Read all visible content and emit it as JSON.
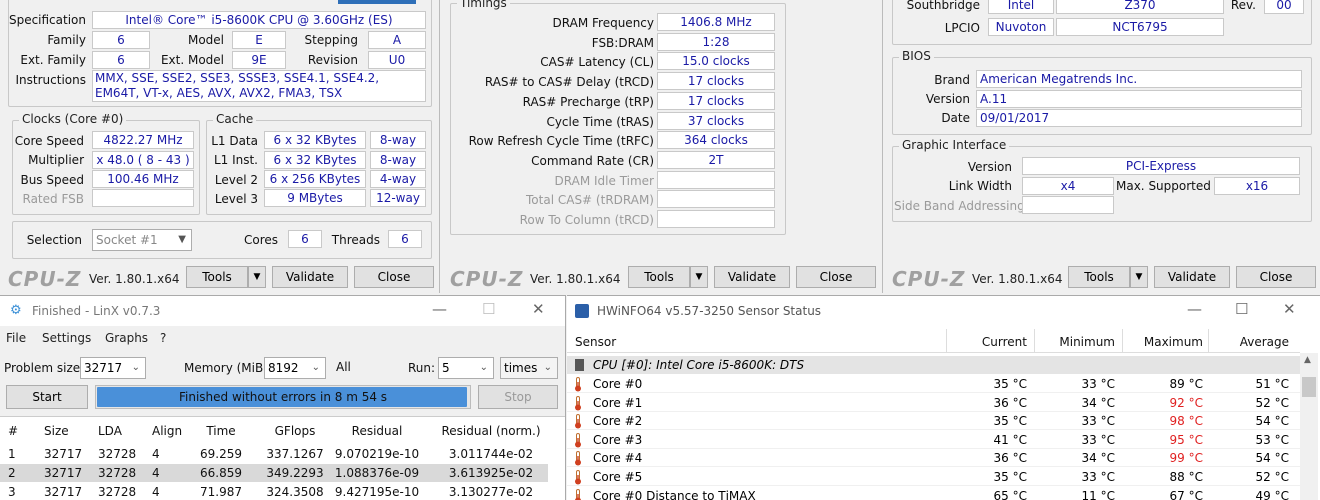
{
  "cpuz1": {
    "spec_label": "Specification",
    "spec_value": "Intel® Core™ i5-8600K CPU @ 3.60GHz (ES)",
    "family_label": "Family",
    "family": "6",
    "model_label": "Model",
    "model": "E",
    "stepping_label": "Stepping",
    "stepping": "A",
    "extfamily_label": "Ext. Family",
    "extfamily": "6",
    "extmodel_label": "Ext. Model",
    "extmodel": "9E",
    "revision_label": "Revision",
    "revision": "U0",
    "instr_label": "Instructions",
    "instr_value": "MMX, SSE, SSE2, SSE3, SSSE3, SSE4.1, SSE4.2, EM64T, VT-x, AES, AVX, AVX2, FMA3, TSX",
    "clocks_title": "Clocks (Core #0)",
    "corespeed_label": "Core Speed",
    "corespeed": "4822.27 MHz",
    "mult_label": "Multiplier",
    "mult": "x 48.0 ( 8 - 43 )",
    "bus_label": "Bus Speed",
    "bus": "100.46 MHz",
    "fsb_label": "Rated FSB",
    "cache_title": "Cache",
    "l1d_label": "L1 Data",
    "l1d": "6 x 32 KBytes",
    "l1d_way": "8-way",
    "l1i_label": "L1 Inst.",
    "l1i": "6 x 32 KBytes",
    "l1i_way": "8-way",
    "l2_label": "Level 2",
    "l2": "6 x 256 KBytes",
    "l2_way": "4-way",
    "l3_label": "Level 3",
    "l3": "9 MBytes",
    "l3_way": "12-way",
    "selection_label": "Selection",
    "selection": "Socket #1",
    "cores_label": "Cores",
    "cores": "6",
    "threads_label": "Threads",
    "threads": "6"
  },
  "cpuz2": {
    "timings_title": "Timings",
    "rows": [
      {
        "label": "DRAM Frequency",
        "value": "1406.8 MHz",
        "dim": false
      },
      {
        "label": "FSB:DRAM",
        "value": "1:28",
        "dim": false
      },
      {
        "label": "CAS# Latency (CL)",
        "value": "15.0 clocks",
        "dim": false
      },
      {
        "label": "RAS# to CAS# Delay (tRCD)",
        "value": "17 clocks",
        "dim": false
      },
      {
        "label": "RAS# Precharge (tRP)",
        "value": "17 clocks",
        "dim": false
      },
      {
        "label": "Cycle Time (tRAS)",
        "value": "37 clocks",
        "dim": false
      },
      {
        "label": "Row Refresh Cycle Time (tRFC)",
        "value": "364 clocks",
        "dim": false
      },
      {
        "label": "Command Rate (CR)",
        "value": "2T",
        "dim": false
      },
      {
        "label": "DRAM Idle Timer",
        "value": "",
        "dim": true
      },
      {
        "label": "Total CAS# (tRDRAM)",
        "value": "",
        "dim": true
      },
      {
        "label": "Row To Column (tRCD)",
        "value": "",
        "dim": true
      }
    ]
  },
  "cpuz3": {
    "southbridge_label": "Southbridge",
    "sb_vendor": "Intel",
    "sb_model": "Z370",
    "rev_label": "Rev.",
    "rev": "00",
    "lpcio_label": "LPCIO",
    "lpcio_vendor": "Nuvoton",
    "lpcio_model": "NCT6795",
    "bios_title": "BIOS",
    "brand_label": "Brand",
    "brand": "American Megatrends Inc.",
    "version_label": "Version",
    "version": "A.11",
    "date_label": "Date",
    "date": "09/01/2017",
    "gi_title": "Graphic Interface",
    "gi_version_label": "Version",
    "gi_version": "PCI-Express",
    "link_label": "Link Width",
    "link": "x4",
    "maxsup_label": "Max. Supported",
    "maxsup": "x16",
    "sideband_label": "Side Band Addressing"
  },
  "cpuz_footer": {
    "logo": "CPU-Z",
    "version": "Ver. 1.80.1.x64",
    "tools": "Tools",
    "validate": "Validate",
    "close": "Close"
  },
  "linx": {
    "title": "Finished - LinX v0.7.3",
    "menu": [
      "File",
      "Settings",
      "Graphs",
      "?"
    ],
    "problem_label": "Problem size:",
    "problem": "32717",
    "memory_label": "Memory (MiB):",
    "memory": "8192",
    "all": "All",
    "run_label": "Run:",
    "run": "5",
    "times": "times",
    "start": "Start",
    "status": "Finished without errors in 8 m 54 s",
    "stop": "Stop",
    "columns": [
      "#",
      "Size",
      "LDA",
      "Align",
      "Time",
      "GFlops",
      "Residual",
      "Residual (norm.)"
    ],
    "rows": [
      [
        "1",
        "32717",
        "32728",
        "4",
        "69.259",
        "337.1267",
        "9.070219e-10",
        "3.011744e-02"
      ],
      [
        "2",
        "32717",
        "32728",
        "4",
        "66.859",
        "349.2293",
        "1.088376e-09",
        "3.613925e-02"
      ],
      [
        "3",
        "32717",
        "32728",
        "4",
        "71.987",
        "324.3508",
        "9.427195e-10",
        "3.130277e-02"
      ]
    ]
  },
  "hwinfo": {
    "title": "HWiNFO64 v5.57-3250 Sensor Status",
    "columns": [
      "Sensor",
      "Current",
      "Minimum",
      "Maximum",
      "Average"
    ],
    "group": "CPU [#0]: Intel Core i5-8600K: DTS",
    "rows": [
      {
        "name": "Core #0",
        "cur": "35 °C",
        "min": "33 °C",
        "max": "89 °C",
        "avg": "51 °C",
        "hot": false
      },
      {
        "name": "Core #1",
        "cur": "36 °C",
        "min": "34 °C",
        "max": "92 °C",
        "avg": "52 °C",
        "hot": true
      },
      {
        "name": "Core #2",
        "cur": "35 °C",
        "min": "33 °C",
        "max": "98 °C",
        "avg": "54 °C",
        "hot": true
      },
      {
        "name": "Core #3",
        "cur": "41 °C",
        "min": "33 °C",
        "max": "95 °C",
        "avg": "53 °C",
        "hot": true
      },
      {
        "name": "Core #4",
        "cur": "36 °C",
        "min": "34 °C",
        "max": "99 °C",
        "avg": "54 °C",
        "hot": true
      },
      {
        "name": "Core #5",
        "cur": "35 °C",
        "min": "33 °C",
        "max": "88 °C",
        "avg": "52 °C",
        "hot": false
      },
      {
        "name": "Core #0 Distance to TjMAX",
        "cur": "65 °C",
        "min": "11 °C",
        "max": "67 °C",
        "avg": "49 °C",
        "hot": false
      }
    ]
  },
  "colors": {
    "value_text": "#1a1aa6",
    "hot": "#e02020",
    "progress": "#4a90d9"
  }
}
